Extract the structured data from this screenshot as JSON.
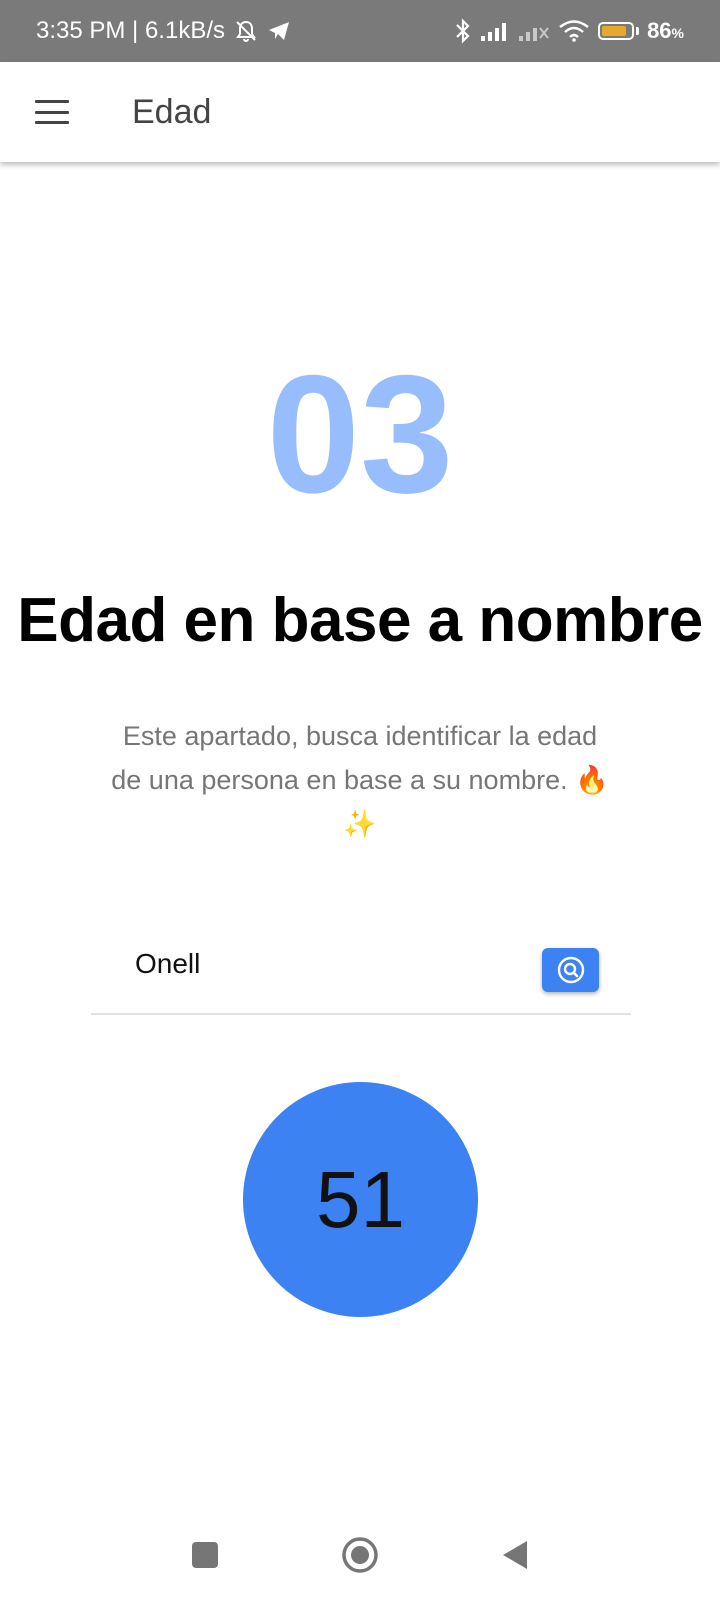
{
  "status_bar": {
    "time_speed": "3:35 PM | 6.1kB/s",
    "battery_percent": "86",
    "battery_percent_sign": "%",
    "battery_level": 0.86,
    "battery_color": "#e7a82d",
    "icons": [
      "mute-bell-icon",
      "telegram-icon",
      "bluetooth-icon",
      "signal-icon",
      "signal-no-service-icon",
      "wifi-icon",
      "battery-icon"
    ]
  },
  "app_bar": {
    "menu_icon": "hamburger-menu-icon",
    "title": "Edad"
  },
  "main": {
    "section_number": "03",
    "heading": "Edad en base a nombre",
    "description_line1": "Este apartado, busca identificar la edad",
    "description_line2": "de una persona en base a su nombre. 🔥",
    "description_line3": "✨"
  },
  "search": {
    "value": "Onell",
    "button_icon": "search-icon"
  },
  "result": {
    "age": "51"
  },
  "colors": {
    "accent": "#3d82f2",
    "number_light": "#98bdfc",
    "status_bar": "#7a7a7a"
  },
  "nav_bar": {
    "icons": [
      "recents-square-icon",
      "home-circle-icon",
      "back-triangle-icon"
    ]
  }
}
